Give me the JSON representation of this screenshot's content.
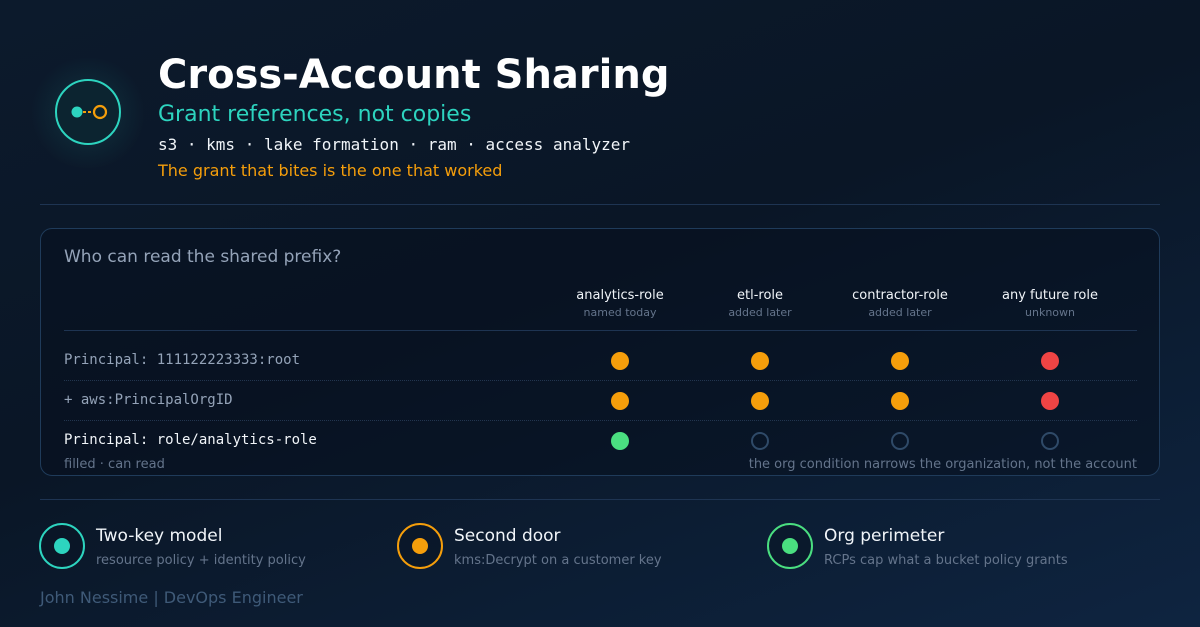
{
  "header": {
    "title": "Cross-Account Sharing",
    "subtitle": "Grant references, not copies",
    "services": "s3 · kms · lake formation · ram · access analyzer",
    "tagline": "The grant that bites is the one that worked",
    "logo_icon": "share-link-icon"
  },
  "matrix": {
    "title": "Who can read the shared prefix?",
    "columns": [
      {
        "label": "analytics-role",
        "sub": "named today"
      },
      {
        "label": "etl-role",
        "sub": "added later"
      },
      {
        "label": "contractor-role",
        "sub": "added later"
      },
      {
        "label": "any future role",
        "sub": "unknown"
      }
    ],
    "rows": [
      {
        "label": "Principal: 111122223333:root",
        "cells": [
          "orange",
          "orange",
          "orange",
          "red"
        ]
      },
      {
        "label": "+ aws:PrincipalOrgID",
        "cells": [
          "orange",
          "orange",
          "orange",
          "red"
        ]
      },
      {
        "label": "Principal: role/analytics-role",
        "cells": [
          "green",
          "none",
          "none",
          "none"
        ]
      }
    ],
    "legend": "filled · can read",
    "footnote": "the org condition narrows the organization, not the account",
    "colors": {
      "orange": "#f59e0b",
      "red": "#ef4444",
      "green": "#4ade80",
      "none_outline": "#2f4a68"
    }
  },
  "cards": [
    {
      "title": "Two-key model",
      "desc": "resource policy + identity policy",
      "color": "#2dd4bf",
      "icon": "two-key-icon"
    },
    {
      "title": "Second door",
      "desc": "kms:Decrypt on a customer key",
      "color": "#f59e0b",
      "icon": "kms-key-icon"
    },
    {
      "title": "Org perimeter",
      "desc": "RCPs cap what a bucket policy grants",
      "color": "#4ade80",
      "icon": "org-perimeter-icon"
    }
  ],
  "footer": {
    "author": "John Nessime | DevOps Engineer"
  }
}
